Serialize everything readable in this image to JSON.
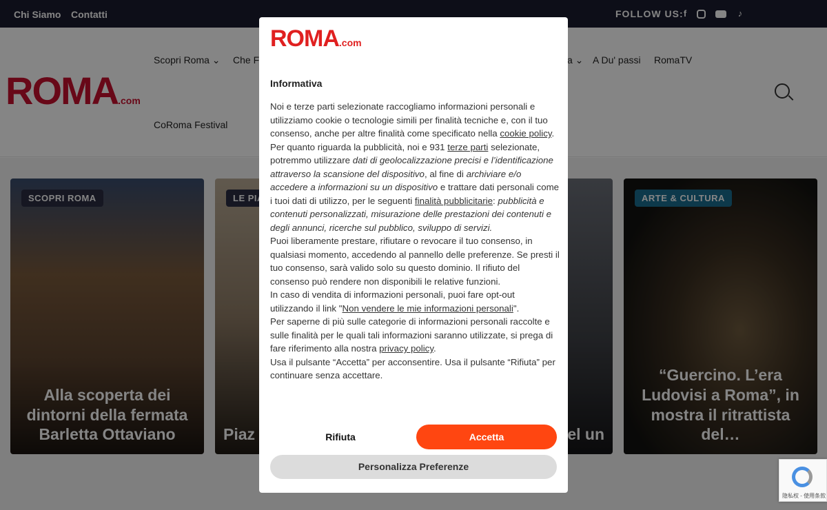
{
  "topbar": {
    "links": [
      "Chi Siamo",
      "Contatti"
    ],
    "follow_label": "FOLLOW US:",
    "social_icons": [
      "facebook-icon",
      "instagram-icon",
      "youtube-icon",
      "tiktok-icon"
    ]
  },
  "header": {
    "logo_text": "ROMA",
    "logo_suffix": ".com",
    "nav": [
      "Scopri Roma",
      "Che F",
      "a",
      "A Du' passi",
      "RomaTV",
      "CoRoma Festival"
    ]
  },
  "cards": [
    {
      "badge": "SCOPRI ROMA",
      "title": "Alla scoperta dei dintorni della fermata Barletta Ottaviano",
      "badge_color": "#2b2d42"
    },
    {
      "badge": "LE PIA",
      "title": "Piaz un p di R",
      "badge_color": "#2b2d42"
    },
    {
      "badge": "",
      "title": "n de nel un",
      "badge_color": "#2b2d42"
    },
    {
      "badge": "ARTE & CULTURA",
      "title": "“Guercino. L’era Ludovisi a Roma”, in mostra il ritrattista del…",
      "badge_color": "#1a6e91"
    }
  ],
  "modal": {
    "logo_text": "ROMA",
    "logo_suffix": ".com",
    "heading": "Informativa",
    "p1_a": "Noi e terze parti selezionate raccogliamo informazioni personali e utilizziamo cookie o tecnologie simili per finalità tecniche e, con il tuo consenso, anche per altre finalità come specificato nella ",
    "p1_link": "cookie policy",
    "p1_b": ".",
    "p2_a": "Per quanto riguarda la pubblicità, noi e 931 ",
    "p2_link1": "terze parti",
    "p2_b": " selezionate, potremmo utilizzare ",
    "p2_i1": "dati di geolocalizzazione precisi e l’identificazione attraverso la scansione del dispositivo",
    "p2_c": ", al fine di ",
    "p2_i2": "archiviare e/o accedere a informazioni su un dispositivo",
    "p2_d": " e trattare dati personali come i tuoi dati di utilizzo, per le seguenti ",
    "p2_link2": "finalità pubblicitarie",
    "p2_e": ": ",
    "p2_i3": "pubblicità e contenuti personalizzati, misurazione delle prestazioni dei contenuti e degli annunci, ricerche sul pubblico, sviluppo di servizi.",
    "p3": "Puoi liberamente prestare, rifiutare o revocare il tuo consenso, in qualsiasi momento, accedendo al pannello delle preferenze. Se presti il tuo consenso, sarà valido solo su questo dominio. Il rifiuto del consenso può rendere non disponibili le relative funzioni.",
    "p4_a": "In caso di vendita di informazioni personali, puoi fare opt-out utilizzando il link \"",
    "p4_link": "Non vendere le mie informazioni personali",
    "p4_b": "\".",
    "p5_a": "Per saperne di più sulle categorie di informazioni personali raccolte e sulle finalità per le quali tali informazioni saranno utilizzate, si prega di fare riferimento alla nostra ",
    "p5_link": "privacy policy",
    "p5_b": ".",
    "p6": "Usa il pulsante “Accetta” per acconsentire. Usa il pulsante “Rifiuta” per continuare senza accettare.",
    "btn_reject": "Rifiuta",
    "btn_accept": "Accetta",
    "btn_customize": "Personalizza Preferenze"
  },
  "recaptcha": {
    "footer": "隐私权 - 使用条款"
  }
}
